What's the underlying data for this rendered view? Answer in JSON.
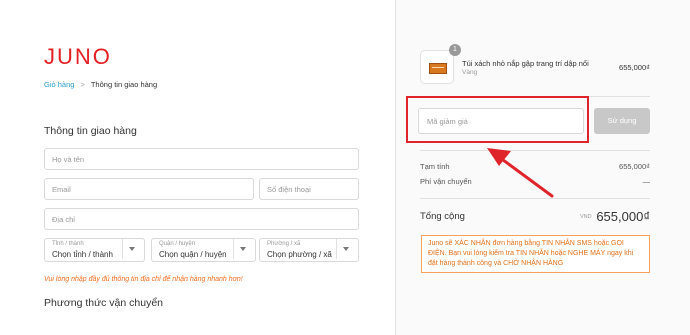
{
  "brand": {
    "logo": "JUNO"
  },
  "breadcrumb": {
    "cart": "Giỏ hàng",
    "separator": ">",
    "current": "Thông tin giao hàng"
  },
  "shipping": {
    "title": "Thông tin giao hàng",
    "name_placeholder": "Họ và tên",
    "email_placeholder": "Email",
    "phone_placeholder": "Số điện thoại",
    "address_placeholder": "Địa chỉ",
    "province": {
      "label": "Tỉnh / thành",
      "value": "Chọn tỉnh / thành"
    },
    "district": {
      "label": "Quận / huyện",
      "value": "Chọn quận / huyện"
    },
    "ward": {
      "label": "Phường / xã",
      "value": "Chọn phường / xã"
    },
    "warning": "Vui lòng nhập đầy đủ thông tin địa chỉ để nhận hàng nhanh hơn!"
  },
  "delivery": {
    "title": "Phương thức vận chuyển"
  },
  "order": {
    "product": {
      "name": "Túi xách nhỏ nắp gập trang trí dập nổi",
      "variant": "Vàng",
      "price": "655,000₫",
      "quantity": "1"
    },
    "coupon": {
      "placeholder": "Mã giảm giá",
      "apply_label": "Sử dụng"
    },
    "subtotal": {
      "label": "Tạm tính",
      "value": "655,000₫"
    },
    "shipping_fee": {
      "label": "Phí vận chuyển",
      "value": "—"
    },
    "total": {
      "label": "Tổng cộng",
      "currency": "VND",
      "value": "655,000₫"
    },
    "notice": "Juno sẽ XÁC NHẬN đơn hàng bằng TIN NHẮN SMS hoặc GỌI ĐIỆN. Bạn vui lòng kiểm tra TIN NHẮN hoặc NGHE MÁY ngay khi đặt hàng thành công và CHỜ NHẬN HÀNG"
  },
  "colors": {
    "brand": "#e32124",
    "highlight": "#e0242b",
    "warning": "#f26b1d",
    "link": "#2a9dcc"
  },
  "icons": [
    "chevron-right-icon",
    "caret-down-icon",
    "handbag-icon",
    "red-arrow-annotation"
  ]
}
